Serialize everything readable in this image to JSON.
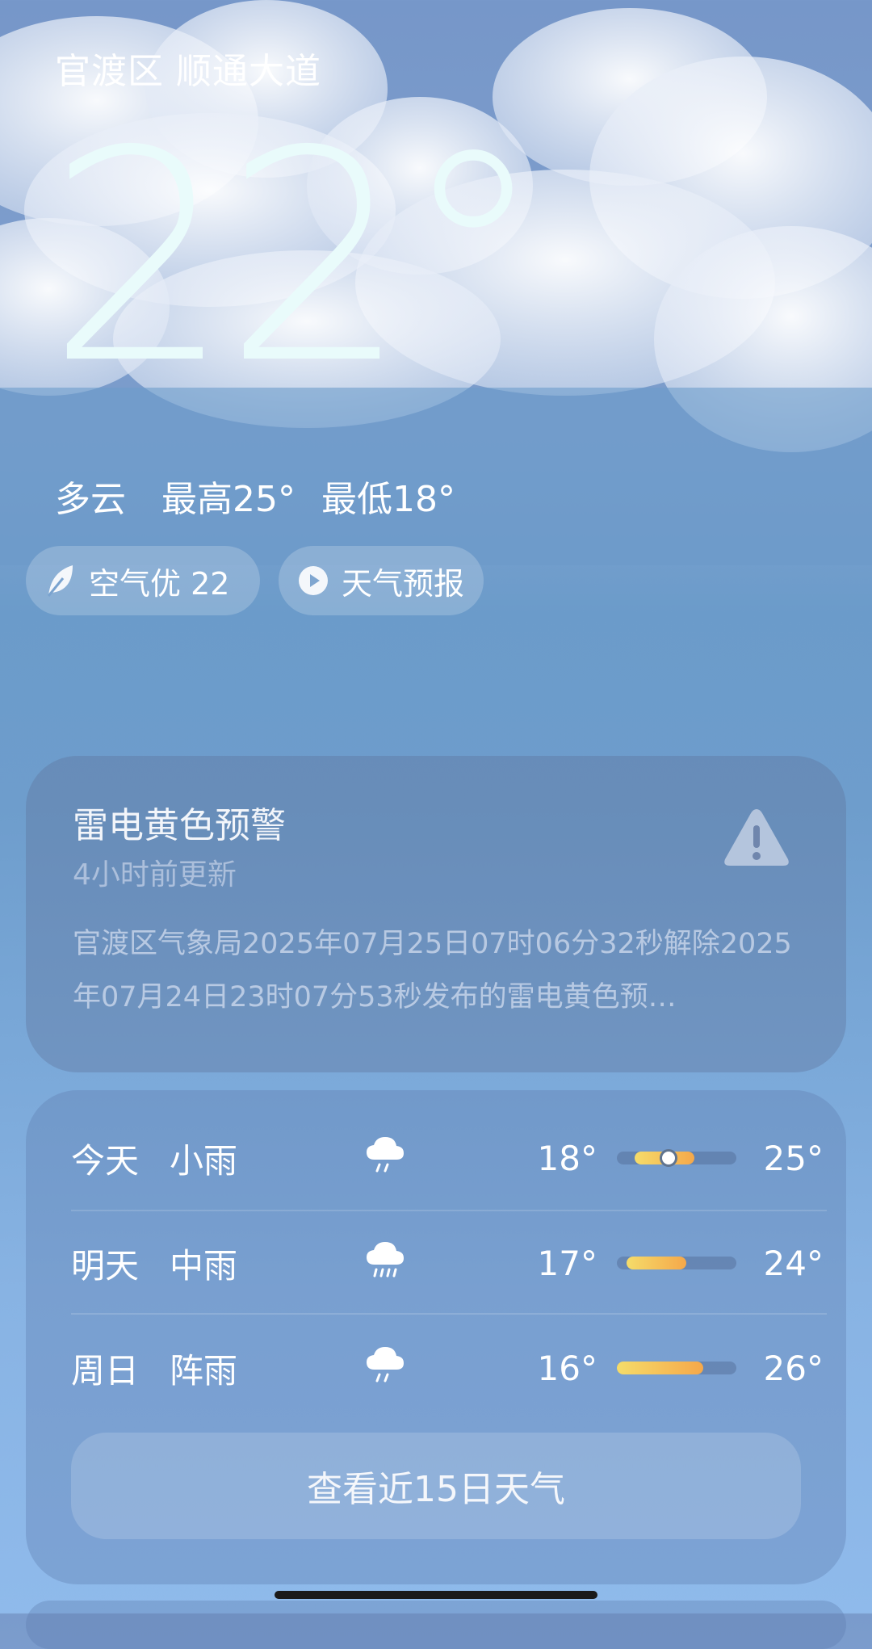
{
  "location": "官渡区 顺通大道",
  "current": {
    "temperature": "22°",
    "condition": "多云",
    "high": "最高25°",
    "low": "最低18°"
  },
  "pills": {
    "air_quality": "空气优 22",
    "forecast_video": "天气预报"
  },
  "alert": {
    "title": "雷电黄色预警",
    "updated": "4小时前更新",
    "body": "官渡区气象局2025年07月25日07时06分32秒解除2025年07月24日23时07分53秒发布的雷电黄色预…",
    "icon": "warning-triangle-icon"
  },
  "forecast": {
    "days": [
      {
        "day": "今天",
        "condition": "小雨",
        "icon": "light-rain-icon",
        "low": "18°",
        "high": "25°",
        "bar": [
          0.15,
          0.65
        ],
        "current": 0.42
      },
      {
        "day": "明天",
        "condition": "中雨",
        "icon": "moderate-rain-icon",
        "low": "17°",
        "high": "24°",
        "bar": [
          0.08,
          0.58
        ],
        "current": null
      },
      {
        "day": "周日",
        "condition": "阵雨",
        "icon": "shower-icon",
        "low": "16°",
        "high": "26°",
        "bar": [
          0.0,
          0.72
        ],
        "current": null
      }
    ],
    "more_button": "查看近15日天气"
  },
  "colors": {
    "bar_start": "#f5dc6a",
    "bar_end": "#f5a84a",
    "temp_big": "#e9fbfb"
  }
}
